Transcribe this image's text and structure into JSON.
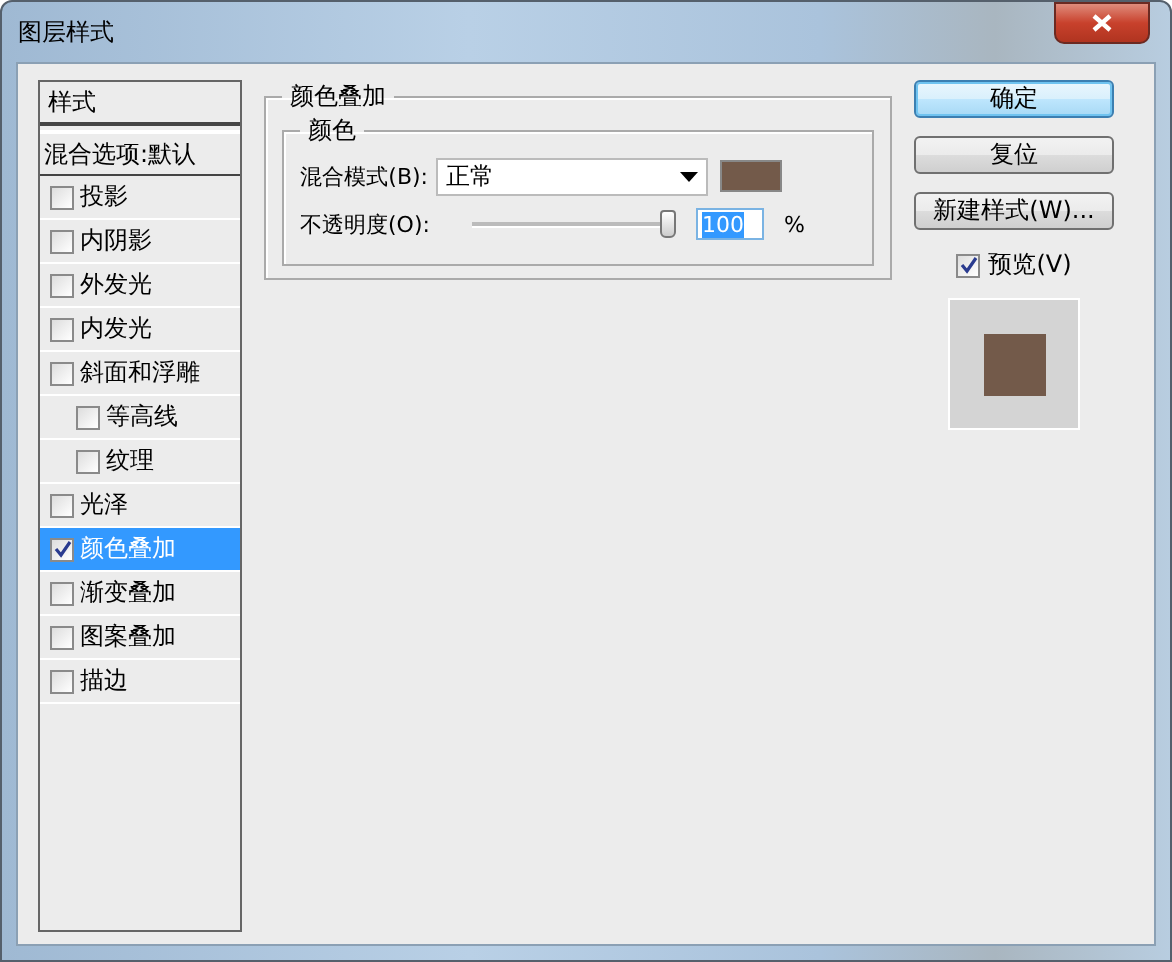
{
  "window": {
    "title": "图层样式"
  },
  "styles_list": {
    "header": "样式",
    "blend_options": "混合选项:默认",
    "items": [
      {
        "label": "投影",
        "checked": false,
        "selected": false
      },
      {
        "label": "内阴影",
        "checked": false,
        "selected": false
      },
      {
        "label": "外发光",
        "checked": false,
        "selected": false
      },
      {
        "label": "内发光",
        "checked": false,
        "selected": false
      },
      {
        "label": "斜面和浮雕",
        "checked": false,
        "selected": false,
        "children": [
          {
            "label": "等高线",
            "checked": false,
            "selected": false
          },
          {
            "label": "纹理",
            "checked": false,
            "selected": false
          }
        ]
      },
      {
        "label": "光泽",
        "checked": false,
        "selected": false
      },
      {
        "label": "颜色叠加",
        "checked": true,
        "selected": true
      },
      {
        "label": "渐变叠加",
        "checked": false,
        "selected": false
      },
      {
        "label": "图案叠加",
        "checked": false,
        "selected": false
      },
      {
        "label": "描边",
        "checked": false,
        "selected": false
      }
    ]
  },
  "color_overlay": {
    "title": "颜色叠加",
    "group": "颜色",
    "blend_mode_label": "混合模式(B):",
    "blend_mode": "正常",
    "color": "#735a4a",
    "opacity_label": "不透明度(O):",
    "level": 1,
    "opacity_value": "100",
    "unit": "%"
  },
  "buttons": [
    {
      "label": "确定",
      "default": true
    },
    {
      "label": "复位",
      "default": false
    },
    {
      "label": "新建样式(W)...",
      "default": false
    }
  ],
  "preview": {
    "label": "预览(V)",
    "checked": true
  }
}
